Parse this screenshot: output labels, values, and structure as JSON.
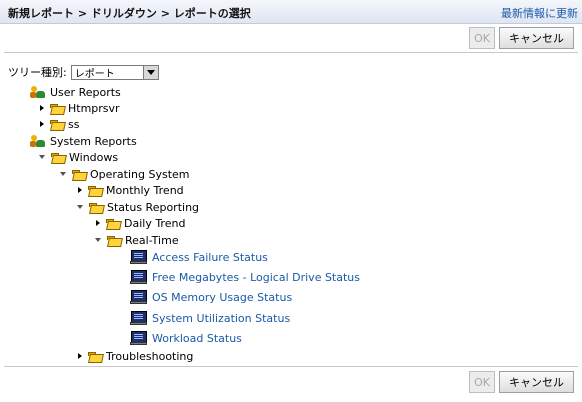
{
  "header": {
    "breadcrumb": "新規レポート > ドリルダウン > レポートの選択",
    "refresh_label": "最新情報に更新"
  },
  "buttons": {
    "ok_label": "OK",
    "cancel_label": "キャンセル"
  },
  "filter": {
    "label": "ツリー種別:",
    "selected": "レポート"
  },
  "tree": {
    "user_reports": "User Reports",
    "htmprsvr": "Htmprsvr",
    "ss": "ss",
    "system_reports": "System Reports",
    "windows": "Windows",
    "operating_system": "Operating System",
    "monthly_trend": "Monthly Trend",
    "status_reporting": "Status Reporting",
    "daily_trend": "Daily Trend",
    "real_time": "Real-Time",
    "access_failure": "Access Failure Status",
    "free_megabytes": "Free Megabytes - Logical Drive Status",
    "os_memory": "OS Memory Usage Status",
    "system_utilization": "System Utilization Status",
    "workload": "Workload Status",
    "troubleshooting": "Troubleshooting"
  },
  "colors": {
    "link": "#1a5aa8",
    "header_bg": "#dfe6f2"
  }
}
